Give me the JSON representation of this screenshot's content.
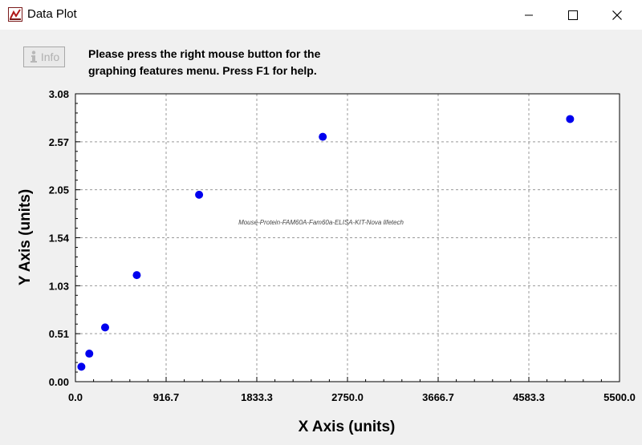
{
  "window": {
    "title": "Data Plot",
    "icons": {
      "app": "data-plot-app-icon",
      "minimize": "minimize-icon",
      "maximize": "maximize-icon",
      "close": "close-icon"
    }
  },
  "toolbar": {
    "info_label": "Info",
    "info_icon": "info-icon"
  },
  "instructions": {
    "line1": "Please press the right mouse button for the",
    "line2": "graphing features menu.  Press F1 for help."
  },
  "chart_data": {
    "type": "scatter",
    "annotation": "Mouse-Protein-FAM60A-Fam60a-ELISA-KIT-Nova lifetech",
    "xlabel": "X Axis (units)",
    "ylabel": "Y Axis (units)",
    "xlim": [
      0,
      5500
    ],
    "ylim": [
      0,
      3.08
    ],
    "x_ticks": [
      "0.0",
      "916.7",
      "1833.3",
      "2750.0",
      "3666.7",
      "4583.3",
      "5500.0"
    ],
    "y_ticks": [
      "0.00",
      "0.51",
      "1.03",
      "1.54",
      "2.05",
      "2.57",
      "3.08"
    ],
    "grid": true,
    "point_color": "#0000ee",
    "points": [
      {
        "x": 60,
        "y": 0.16
      },
      {
        "x": 140,
        "y": 0.3
      },
      {
        "x": 300,
        "y": 0.58
      },
      {
        "x": 620,
        "y": 1.14
      },
      {
        "x": 1250,
        "y": 2.0
      },
      {
        "x": 2500,
        "y": 2.62
      },
      {
        "x": 5000,
        "y": 2.81
      }
    ]
  }
}
